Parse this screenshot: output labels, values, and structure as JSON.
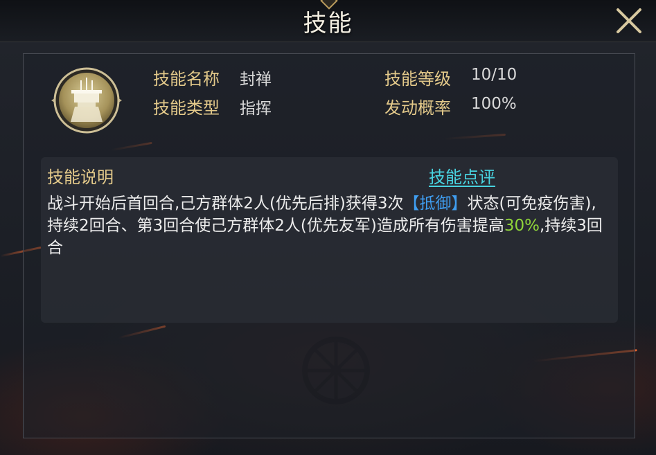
{
  "header": {
    "title": "技能"
  },
  "skill": {
    "icon": "altar-icon",
    "name_label": "技能名称",
    "name_value": "封禅",
    "type_label": "技能类型",
    "type_value": "指挥",
    "level_label": "技能等级",
    "level_value": "10/10",
    "rate_label": "发动概率",
    "rate_value": "100%"
  },
  "description": {
    "label": "技能说明",
    "review_link": "技能点评",
    "text_part1": "战斗开始后首回合,己方群体2人(优先后排)获得3次",
    "keyword": "【抵御】",
    "text_part2": "状态(可免疫伤害),持续2回合、第3回合使己方群体2人(优先友军)造成所有伤害提高",
    "highlight": "30%",
    "text_part3": ",持续3回合"
  },
  "colors": {
    "label_gold": "#e3c98a",
    "link_cyan": "#48d3e0",
    "keyword_blue": "#3f9df0",
    "highlight_green": "#8fd43a"
  }
}
